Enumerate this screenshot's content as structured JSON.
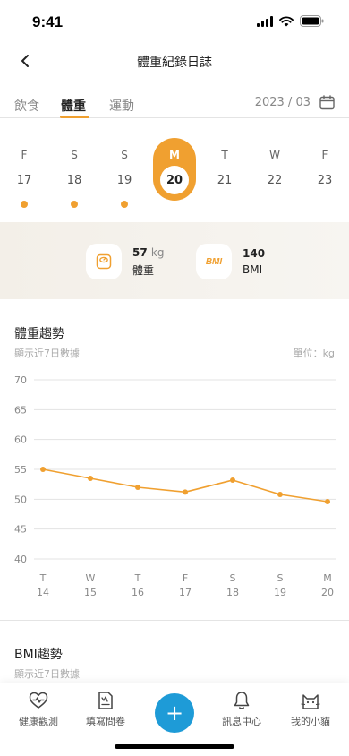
{
  "status_bar": {
    "time": "9:41"
  },
  "nav": {
    "title": "體重紀錄日誌"
  },
  "tabs": [
    {
      "label": "飲食",
      "active": false
    },
    {
      "label": "體重",
      "active": true
    },
    {
      "label": "運動",
      "active": false
    }
  ],
  "month_selector": {
    "label": "2023 / 03"
  },
  "week": [
    {
      "letter": "F",
      "day": "17",
      "has_record": true,
      "selected": false
    },
    {
      "letter": "S",
      "day": "18",
      "has_record": true,
      "selected": false
    },
    {
      "letter": "S",
      "day": "19",
      "has_record": true,
      "selected": false
    },
    {
      "letter": "M",
      "day": "20",
      "has_record": false,
      "selected": true
    },
    {
      "letter": "T",
      "day": "21",
      "has_record": false,
      "selected": false
    },
    {
      "letter": "W",
      "day": "22",
      "has_record": false,
      "selected": false
    },
    {
      "letter": "F",
      "day": "23",
      "has_record": false,
      "selected": false
    }
  ],
  "summary": {
    "weight": {
      "value": "57",
      "unit": "kg",
      "label": "體重",
      "icon": "scale-icon"
    },
    "bmi": {
      "value": "140",
      "label": "BMI",
      "badge": "BMI",
      "icon": "bmi-icon"
    }
  },
  "weight_trend": {
    "title": "體重趨勢",
    "subtitle": "顯示近7日數據",
    "unit_label": "單位：kg"
  },
  "bmi_trend": {
    "title": "BMI趨勢",
    "subtitle": "顯示近7日數據"
  },
  "chart_data": {
    "type": "line",
    "title": "",
    "xlabel": "",
    "ylabel": "",
    "x": [
      "T\n14",
      "W\n15",
      "T\n16",
      "F\n17",
      "S\n18",
      "S\n19",
      "M\n20"
    ],
    "x_letters": [
      "T",
      "W",
      "T",
      "F",
      "S",
      "S",
      "M"
    ],
    "x_days": [
      "14",
      "15",
      "16",
      "17",
      "18",
      "19",
      "20"
    ],
    "series": [
      {
        "values": [
          55.0,
          53.5,
          52.0,
          51.2,
          53.2,
          50.8,
          49.6
        ],
        "color": "#f0a030"
      }
    ],
    "ylim": [
      40,
      70
    ],
    "yticks": [
      70,
      65,
      60,
      55,
      50,
      45,
      40
    ],
    "grid": true,
    "legend": "none"
  },
  "bottom_tabs": [
    {
      "label": "健康觀測",
      "icon": "heart-pulse-icon"
    },
    {
      "label": "填寫問卷",
      "icon": "clipboard-icon"
    },
    {
      "label": "+",
      "icon": "plus-icon"
    },
    {
      "label": "訊息中心",
      "icon": "bell-icon"
    },
    {
      "label": "我的小貓",
      "icon": "cat-icon"
    }
  ],
  "colors": {
    "accent": "#f0a030",
    "fab": "#1e9bd7"
  }
}
